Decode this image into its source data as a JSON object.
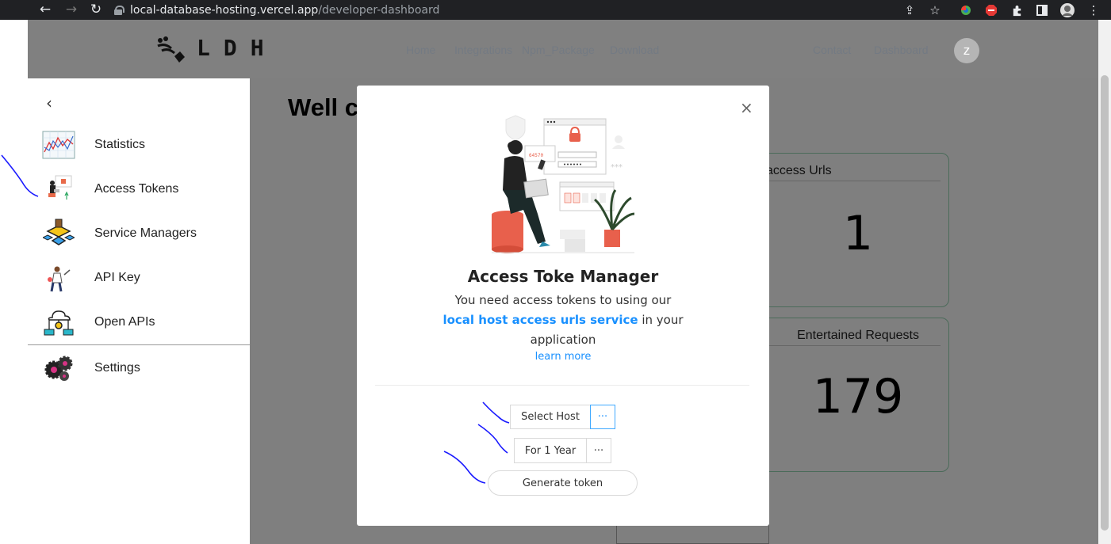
{
  "browser": {
    "url_host": "local-database-hosting.vercel.app",
    "url_path": "/developer-dashboard",
    "nav_back": "←",
    "nav_forward": "→",
    "nav_reload": "↻",
    "share_icon": "⇪",
    "bookmark_icon": "☆",
    "menu_icon": "⋮"
  },
  "header": {
    "logo_text": "LDH",
    "nav": [
      "Home",
      "Integrations",
      "Npm_Package",
      "Download",
      "Contact",
      "Dashboard"
    ],
    "avatar_letter": "z"
  },
  "main": {
    "welcome": "Well c",
    "cards": [
      {
        "title": "Local database access Urls",
        "value": "1"
      },
      {
        "title": "Entertained Requests",
        "value": "179"
      }
    ]
  },
  "sidebar": {
    "back_icon": "‹",
    "items": [
      {
        "label": "Statistics",
        "icon": "chart-icon"
      },
      {
        "label": "Access Tokens",
        "icon": "person-laptop-icon"
      },
      {
        "label": "Service Managers",
        "icon": "network-icon"
      },
      {
        "label": "API Key",
        "icon": "person-key-icon"
      },
      {
        "label": "Open APIs",
        "icon": "cloud-network-icon"
      },
      {
        "label": "Settings",
        "icon": "gears-icon"
      }
    ]
  },
  "modal": {
    "close": "×",
    "title": "Access Toke Manager",
    "line1": "You need access tokens to using our",
    "link_text": "local host access urls service",
    "line2_suffix": " in your",
    "line3": "application",
    "learn_more": "learn more",
    "select_host": "Select Host",
    "duration": "For 1 Year",
    "dots": "···",
    "generate": "Generate token"
  },
  "colors": {
    "accent": "#1890ff",
    "overlay": "#7f7f7f"
  }
}
